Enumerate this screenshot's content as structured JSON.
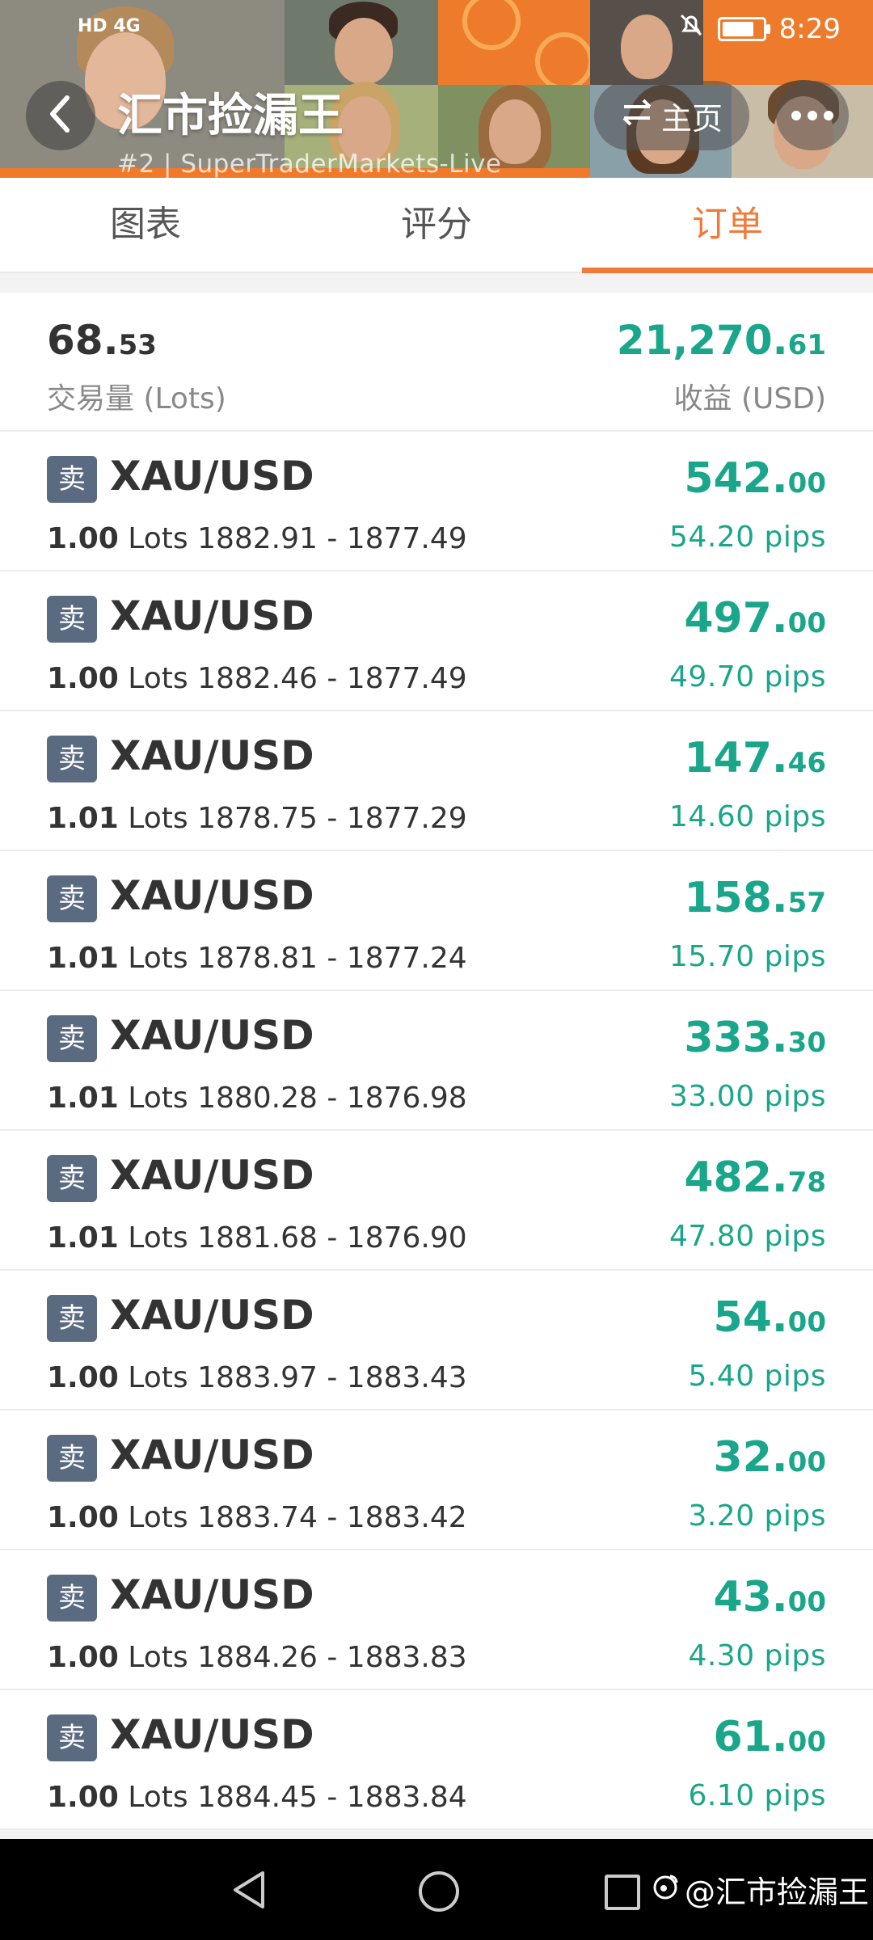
{
  "status_bar": {
    "network": "HD 4G",
    "time": "8:29"
  },
  "header": {
    "title": "汇市捡漏王",
    "subtitle": "#2 | SuperTraderMarkets-Live",
    "home_label": "主页"
  },
  "tabs": [
    {
      "label": "图表",
      "active": false
    },
    {
      "label": "评分",
      "active": false
    },
    {
      "label": "订单",
      "active": true
    }
  ],
  "summary": {
    "volume_int": "68.",
    "volume_dec": "53",
    "volume_label": "交易量 (Lots)",
    "profit_int": "21,270.",
    "profit_dec": "61",
    "profit_label": "收益 (USD)"
  },
  "orders": [
    {
      "side": "卖",
      "symbol": "XAU/USD",
      "lots": "1.00",
      "lots_unit": "Lots",
      "prices": "1882.91 - 1877.49",
      "profit_int": "542.",
      "profit_dec": "00",
      "pips": "54.20 pips"
    },
    {
      "side": "卖",
      "symbol": "XAU/USD",
      "lots": "1.00",
      "lots_unit": "Lots",
      "prices": "1882.46 - 1877.49",
      "profit_int": "497.",
      "profit_dec": "00",
      "pips": "49.70 pips"
    },
    {
      "side": "卖",
      "symbol": "XAU/USD",
      "lots": "1.01",
      "lots_unit": "Lots",
      "prices": "1878.75 - 1877.29",
      "profit_int": "147.",
      "profit_dec": "46",
      "pips": "14.60 pips"
    },
    {
      "side": "卖",
      "symbol": "XAU/USD",
      "lots": "1.01",
      "lots_unit": "Lots",
      "prices": "1878.81 - 1877.24",
      "profit_int": "158.",
      "profit_dec": "57",
      "pips": "15.70 pips"
    },
    {
      "side": "卖",
      "symbol": "XAU/USD",
      "lots": "1.01",
      "lots_unit": "Lots",
      "prices": "1880.28 - 1876.98",
      "profit_int": "333.",
      "profit_dec": "30",
      "pips": "33.00 pips"
    },
    {
      "side": "卖",
      "symbol": "XAU/USD",
      "lots": "1.01",
      "lots_unit": "Lots",
      "prices": "1881.68 - 1876.90",
      "profit_int": "482.",
      "profit_dec": "78",
      "pips": "47.80 pips"
    },
    {
      "side": "卖",
      "symbol": "XAU/USD",
      "lots": "1.00",
      "lots_unit": "Lots",
      "prices": "1883.97 - 1883.43",
      "profit_int": "54.",
      "profit_dec": "00",
      "pips": "5.40 pips"
    },
    {
      "side": "卖",
      "symbol": "XAU/USD",
      "lots": "1.00",
      "lots_unit": "Lots",
      "prices": "1883.74 - 1883.42",
      "profit_int": "32.",
      "profit_dec": "00",
      "pips": "3.20 pips"
    },
    {
      "side": "卖",
      "symbol": "XAU/USD",
      "lots": "1.00",
      "lots_unit": "Lots",
      "prices": "1884.26 - 1883.83",
      "profit_int": "43.",
      "profit_dec": "00",
      "pips": "4.30 pips"
    },
    {
      "side": "卖",
      "symbol": "XAU/USD",
      "lots": "1.00",
      "lots_unit": "Lots",
      "prices": "1884.45 - 1883.84",
      "profit_int": "61.",
      "profit_dec": "00",
      "pips": "6.10 pips"
    }
  ],
  "navbar": {
    "watermark": "@汇市捡漏王"
  },
  "colors": {
    "accent": "#f07a3a",
    "profit": "#1aa68a",
    "badge": "#5a6a80"
  }
}
